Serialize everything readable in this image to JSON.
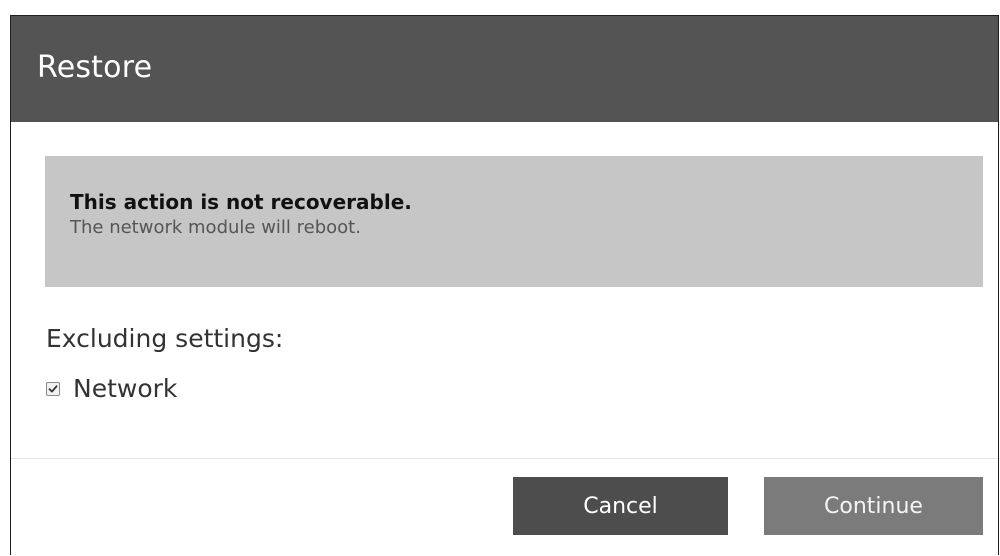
{
  "dialog": {
    "title": "Restore",
    "warning": {
      "title": "This action is not recoverable.",
      "text": "The network module will reboot."
    },
    "excluding_label": "Excluding settings:",
    "settings": [
      {
        "label": "Network",
        "checked": true
      }
    ],
    "buttons": {
      "cancel_label": "Cancel",
      "continue_label": "Continue"
    }
  },
  "colors": {
    "header_bg": "#545454",
    "warning_bg": "#c6c6c6",
    "cancel_bg": "#4d4d4d",
    "continue_bg": "#7b7b7b"
  }
}
